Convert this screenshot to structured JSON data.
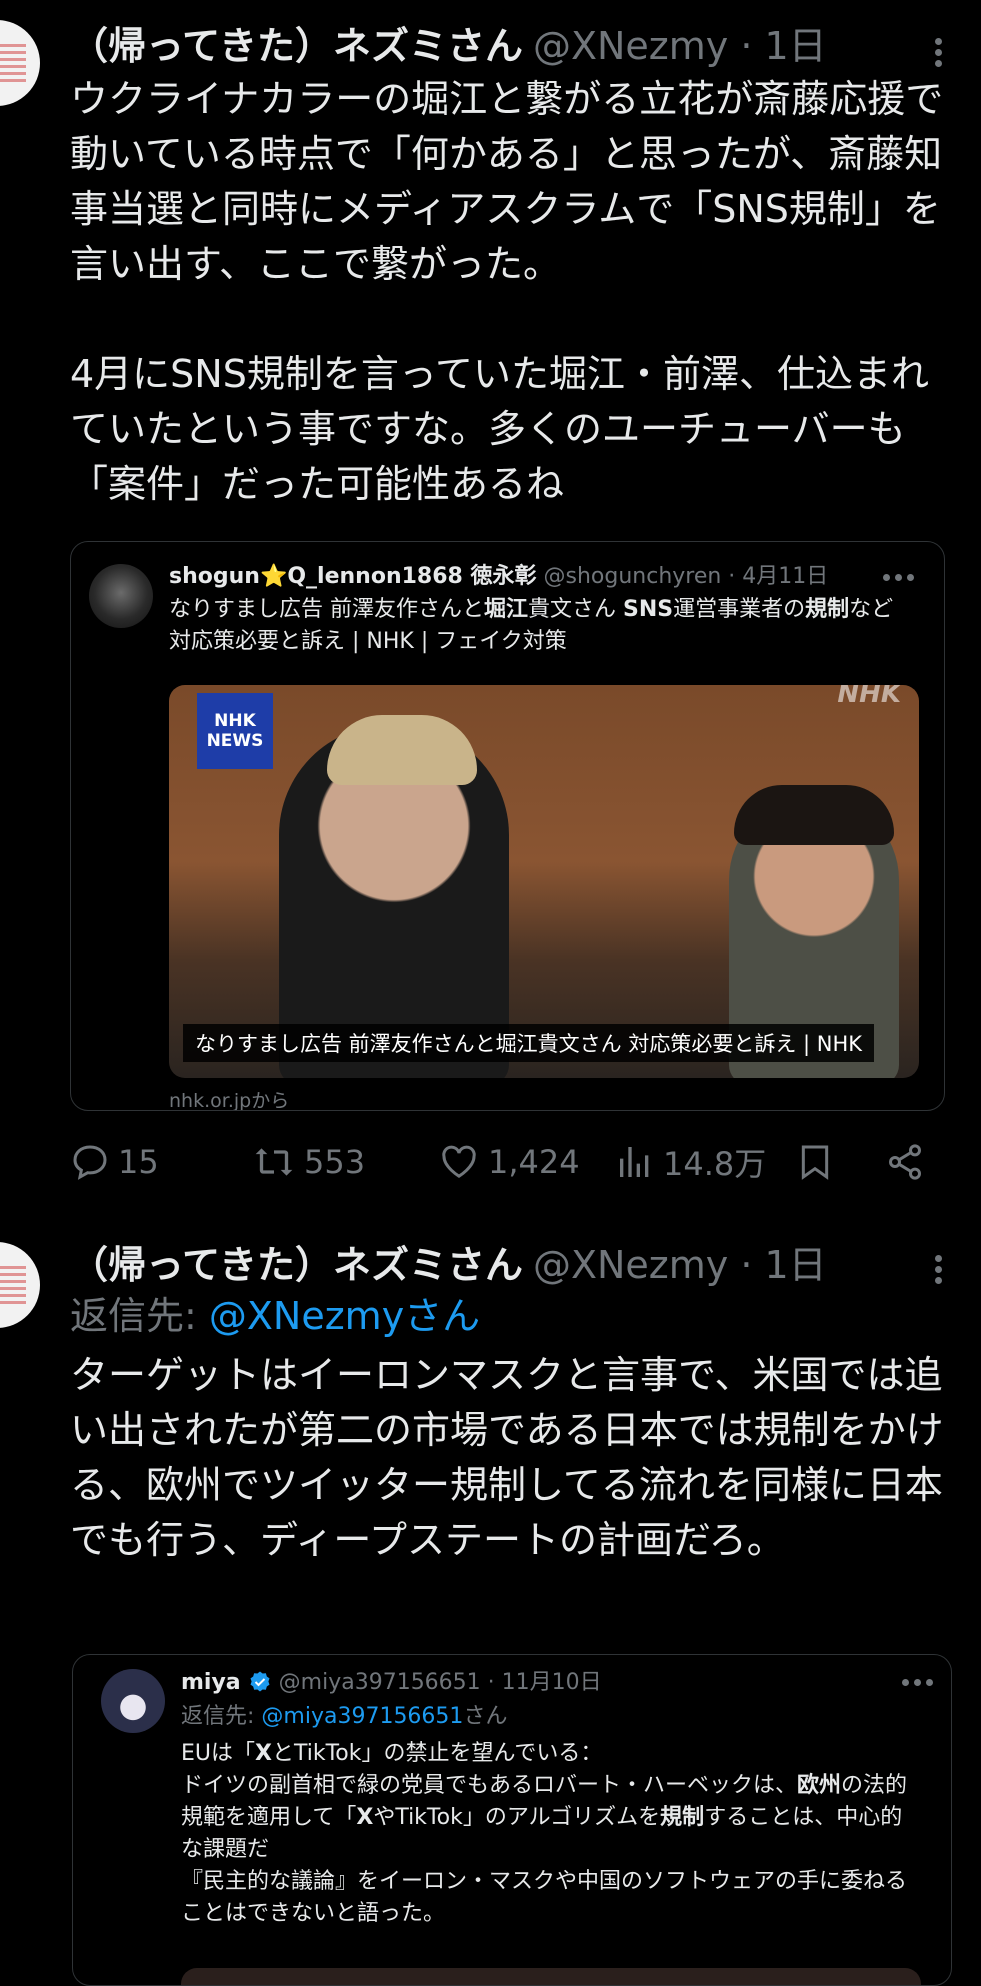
{
  "tweet1": {
    "name": "（帰ってきた）ネズミさん",
    "handle_time": "@XNezmy · 1日",
    "text": "ウクライナカラーの堀江と繋がる立花が斎藤応援で動いている時点で「何かある」と思ったが、斎藤知事当選と同時にメディアスクラムで「SNS規制」を言い出す、ここで繋がった。\n\n4月にSNS規制を言っていた堀江・前澤、仕込まれていたという事ですな。多くのユーチューバーも「案件」だった可能性あるね",
    "quote": {
      "name": "shogun⭐Q_lennon1868 徳永彰",
      "handle_time": "@shogunchyren · 4月11日",
      "text_parts": [
        {
          "t": "なりすまし広告 前澤友作さんと",
          "b": false
        },
        {
          "t": "堀江",
          "b": true
        },
        {
          "t": "貴文さん ",
          "b": false
        },
        {
          "t": "SNS",
          "b": true
        },
        {
          "t": "運営事業者の",
          "b": false
        },
        {
          "t": "規制",
          "b": true
        },
        {
          "t": "など対応策必要と訴え | NHK | フェイク対策",
          "b": false
        }
      ],
      "media": {
        "badge_line1": "NHK",
        "badge_line2": "NEWS",
        "watermark": "NHK",
        "caption": "なりすまし広告 前澤友作さんと堀江貴文さん 対応策必要と訴え | NHK"
      },
      "source": "nhk.or.jpから"
    },
    "actions": {
      "replies": "15",
      "retweets": "553",
      "likes": "1,424",
      "views": "14.8万"
    }
  },
  "tweet2": {
    "name": "（帰ってきた）ネズミさん",
    "handle_time": "@XNezmy · 1日",
    "reply_prefix": "返信先: ",
    "reply_to": "@XNezmyさん",
    "text": "ターゲットはイーロンマスクと言事で、米国では追い出されたが第二の市場である日本では規制をかける、欧州でツイッター規制してる流れを同様に日本でも行う、ディープステートの計画だろ。",
    "quote": {
      "name": "miya",
      "handle_time": "@miya397156651 · 11月10日",
      "reply_prefix": "返信先: ",
      "reply_to": "@miya397156651",
      "reply_suffix": "さん",
      "text_parts": [
        {
          "t": "EUは「",
          "b": false
        },
        {
          "t": "X",
          "b": true
        },
        {
          "t": "とTikTok」の禁止を望んでいる：\nドイツの副首相で緑の党員でもあるロバート・ハーベックは、",
          "b": false
        },
        {
          "t": "欧州",
          "b": true
        },
        {
          "t": "の法的規範を適用して「",
          "b": false
        },
        {
          "t": "X",
          "b": true
        },
        {
          "t": "やTikTok」のアルゴリズムを",
          "b": false
        },
        {
          "t": "規制",
          "b": true
        },
        {
          "t": "することは、中心的な課題だ\n『民主的な議論』をイーロン・マスクや中国のソフトウェアの手に委ねることはできないと語った。",
          "b": false
        }
      ]
    }
  },
  "colors": {
    "accent": "#1d9bf0",
    "muted": "#71767b",
    "text": "#e7e9ea",
    "border": "#2f3336",
    "verified": "#1d9bf0"
  }
}
